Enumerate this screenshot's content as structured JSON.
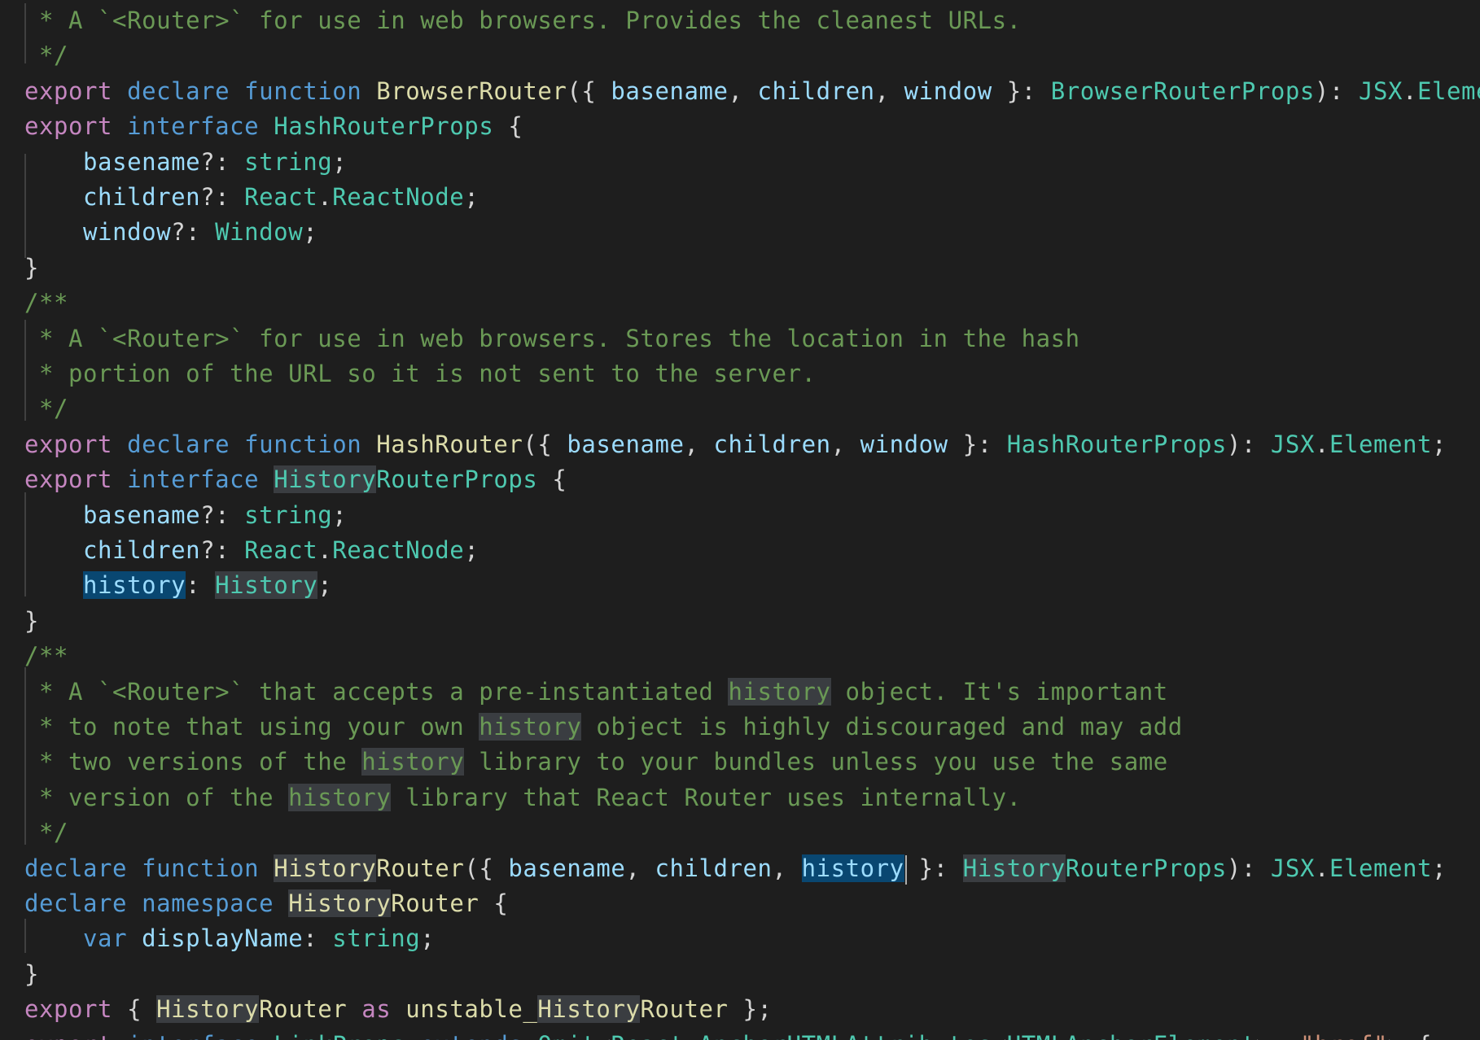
{
  "editor": {
    "language": "typescript",
    "lines": [
      [
        {
          "t": " * A `<Router>` for use in web browsers. Provides the cleanest URLs.",
          "c": "com"
        }
      ],
      [
        {
          "t": " */",
          "c": "com"
        }
      ],
      [
        {
          "t": "export",
          "c": "kw"
        },
        {
          "t": " "
        },
        {
          "t": "declare",
          "c": "kw2"
        },
        {
          "t": " "
        },
        {
          "t": "function",
          "c": "kw2"
        },
        {
          "t": " "
        },
        {
          "t": "BrowserRouter",
          "c": "fn"
        },
        {
          "t": "({ "
        },
        {
          "t": "basename",
          "c": "var"
        },
        {
          "t": ", "
        },
        {
          "t": "children",
          "c": "var"
        },
        {
          "t": ", "
        },
        {
          "t": "window",
          "c": "var"
        },
        {
          "t": " }: "
        },
        {
          "t": "BrowserRouterProps",
          "c": "ty"
        },
        {
          "t": "): "
        },
        {
          "t": "JSX",
          "c": "ty"
        },
        {
          "t": "."
        },
        {
          "t": "Element",
          "c": "ty"
        },
        {
          "t": ";"
        }
      ],
      [
        {
          "t": "export",
          "c": "kw"
        },
        {
          "t": " "
        },
        {
          "t": "interface",
          "c": "kw2"
        },
        {
          "t": " "
        },
        {
          "t": "HashRouterProps",
          "c": "ty"
        },
        {
          "t": " {"
        }
      ],
      [
        {
          "t": "    "
        },
        {
          "t": "basename",
          "c": "var"
        },
        {
          "t": "?: "
        },
        {
          "t": "string",
          "c": "ty"
        },
        {
          "t": ";"
        }
      ],
      [
        {
          "t": "    "
        },
        {
          "t": "children",
          "c": "var"
        },
        {
          "t": "?: "
        },
        {
          "t": "React",
          "c": "ty"
        },
        {
          "t": "."
        },
        {
          "t": "ReactNode",
          "c": "ty"
        },
        {
          "t": ";"
        }
      ],
      [
        {
          "t": "    "
        },
        {
          "t": "window",
          "c": "var"
        },
        {
          "t": "?: "
        },
        {
          "t": "Window",
          "c": "ty"
        },
        {
          "t": ";"
        }
      ],
      [
        {
          "t": "}"
        }
      ],
      [
        {
          "t": "/**",
          "c": "com"
        }
      ],
      [
        {
          "t": " * A `<Router>` for use in web browsers. Stores the location in the hash",
          "c": "com"
        }
      ],
      [
        {
          "t": " * portion of the URL so it is not sent to the server.",
          "c": "com"
        }
      ],
      [
        {
          "t": " */",
          "c": "com"
        }
      ],
      [
        {
          "t": "export",
          "c": "kw"
        },
        {
          "t": " "
        },
        {
          "t": "declare",
          "c": "kw2"
        },
        {
          "t": " "
        },
        {
          "t": "function",
          "c": "kw2"
        },
        {
          "t": " "
        },
        {
          "t": "HashRouter",
          "c": "fn"
        },
        {
          "t": "({ "
        },
        {
          "t": "basename",
          "c": "var"
        },
        {
          "t": ", "
        },
        {
          "t": "children",
          "c": "var"
        },
        {
          "t": ", "
        },
        {
          "t": "window",
          "c": "var"
        },
        {
          "t": " }: "
        },
        {
          "t": "HashRouterProps",
          "c": "ty"
        },
        {
          "t": "): "
        },
        {
          "t": "JSX",
          "c": "ty"
        },
        {
          "t": "."
        },
        {
          "t": "Element",
          "c": "ty"
        },
        {
          "t": ";"
        }
      ],
      [
        {
          "t": "export",
          "c": "kw"
        },
        {
          "t": " "
        },
        {
          "t": "interface",
          "c": "kw2"
        },
        {
          "t": " "
        },
        {
          "t": "History",
          "c": "ty",
          "h": "hl"
        },
        {
          "t": "RouterProps",
          "c": "ty"
        },
        {
          "t": " {"
        }
      ],
      [
        {
          "t": "    "
        },
        {
          "t": "basename",
          "c": "var"
        },
        {
          "t": "?: "
        },
        {
          "t": "string",
          "c": "ty"
        },
        {
          "t": ";"
        }
      ],
      [
        {
          "t": "    "
        },
        {
          "t": "children",
          "c": "var"
        },
        {
          "t": "?: "
        },
        {
          "t": "React",
          "c": "ty"
        },
        {
          "t": "."
        },
        {
          "t": "ReactNode",
          "c": "ty"
        },
        {
          "t": ";"
        }
      ],
      [
        {
          "t": "    "
        },
        {
          "t": "history",
          "c": "var",
          "h": "hl-sel"
        },
        {
          "t": ": "
        },
        {
          "t": "History",
          "c": "ty",
          "h": "hl"
        },
        {
          "t": ";"
        }
      ],
      [
        {
          "t": "}"
        }
      ],
      [
        {
          "t": "/**",
          "c": "com"
        }
      ],
      [
        {
          "t": " * A `<Router>` that accepts a pre-instantiated ",
          "c": "com"
        },
        {
          "t": "history",
          "c": "com",
          "h": "hl"
        },
        {
          "t": " object. It's important",
          "c": "com"
        }
      ],
      [
        {
          "t": " * to note that using your own ",
          "c": "com"
        },
        {
          "t": "history",
          "c": "com",
          "h": "hl"
        },
        {
          "t": " object is highly discouraged and may add",
          "c": "com"
        }
      ],
      [
        {
          "t": " * two versions of the ",
          "c": "com"
        },
        {
          "t": "history",
          "c": "com",
          "h": "hl"
        },
        {
          "t": " library to your bundles unless you use the same",
          "c": "com"
        }
      ],
      [
        {
          "t": " * version of the ",
          "c": "com"
        },
        {
          "t": "history",
          "c": "com",
          "h": "hl"
        },
        {
          "t": " library that React Router uses internally.",
          "c": "com"
        }
      ],
      [
        {
          "t": " */",
          "c": "com"
        }
      ],
      [
        {
          "t": "declare",
          "c": "kw2"
        },
        {
          "t": " "
        },
        {
          "t": "function",
          "c": "kw2"
        },
        {
          "t": " "
        },
        {
          "t": "History",
          "c": "fn",
          "h": "hl"
        },
        {
          "t": "Router",
          "c": "fn"
        },
        {
          "t": "({ "
        },
        {
          "t": "basename",
          "c": "var"
        },
        {
          "t": ", "
        },
        {
          "t": "children",
          "c": "var"
        },
        {
          "t": ", "
        },
        {
          "t": "history",
          "c": "var",
          "h": "hl-sel",
          "cursor": true
        },
        {
          "t": " }: "
        },
        {
          "t": "History",
          "c": "ty",
          "h": "hl"
        },
        {
          "t": "RouterProps",
          "c": "ty"
        },
        {
          "t": "): "
        },
        {
          "t": "JSX",
          "c": "ty"
        },
        {
          "t": "."
        },
        {
          "t": "Element",
          "c": "ty"
        },
        {
          "t": ";"
        }
      ],
      [
        {
          "t": "declare",
          "c": "kw2"
        },
        {
          "t": " "
        },
        {
          "t": "namespace",
          "c": "kw2"
        },
        {
          "t": " "
        },
        {
          "t": "History",
          "c": "fn",
          "h": "hl"
        },
        {
          "t": "Router",
          "c": "fn"
        },
        {
          "t": " {"
        }
      ],
      [
        {
          "t": "    "
        },
        {
          "t": "var",
          "c": "kw2"
        },
        {
          "t": " "
        },
        {
          "t": "displayName",
          "c": "var"
        },
        {
          "t": ": "
        },
        {
          "t": "string",
          "c": "ty"
        },
        {
          "t": ";"
        }
      ],
      [
        {
          "t": "}"
        }
      ],
      [
        {
          "t": "export",
          "c": "kw"
        },
        {
          "t": " { "
        },
        {
          "t": "History",
          "c": "fn",
          "h": "hl"
        },
        {
          "t": "Router",
          "c": "fn"
        },
        {
          "t": " "
        },
        {
          "t": "as",
          "c": "kw"
        },
        {
          "t": " "
        },
        {
          "t": "unstable_",
          "c": "fn"
        },
        {
          "t": "History",
          "c": "fn",
          "h": "hl"
        },
        {
          "t": "Router",
          "c": "fn"
        },
        {
          "t": " };"
        }
      ],
      [
        {
          "t": "export",
          "c": "kw"
        },
        {
          "t": " "
        },
        {
          "t": "interface",
          "c": "kw2"
        },
        {
          "t": " "
        },
        {
          "t": "LinkProps",
          "c": "ty"
        },
        {
          "t": " "
        },
        {
          "t": "extends",
          "c": "kw2"
        },
        {
          "t": " "
        },
        {
          "t": "Omit",
          "c": "ty"
        },
        {
          "t": "<"
        },
        {
          "t": "React",
          "c": "ty"
        },
        {
          "t": "."
        },
        {
          "t": "AnchorHTMLAttributes",
          "c": "ty"
        },
        {
          "t": "<"
        },
        {
          "t": "HTMLAnchorElement",
          "c": "ty"
        },
        {
          "t": ">, "
        },
        {
          "t": "\"href\"",
          "c": "str"
        },
        {
          "t": "> {"
        }
      ]
    ]
  }
}
